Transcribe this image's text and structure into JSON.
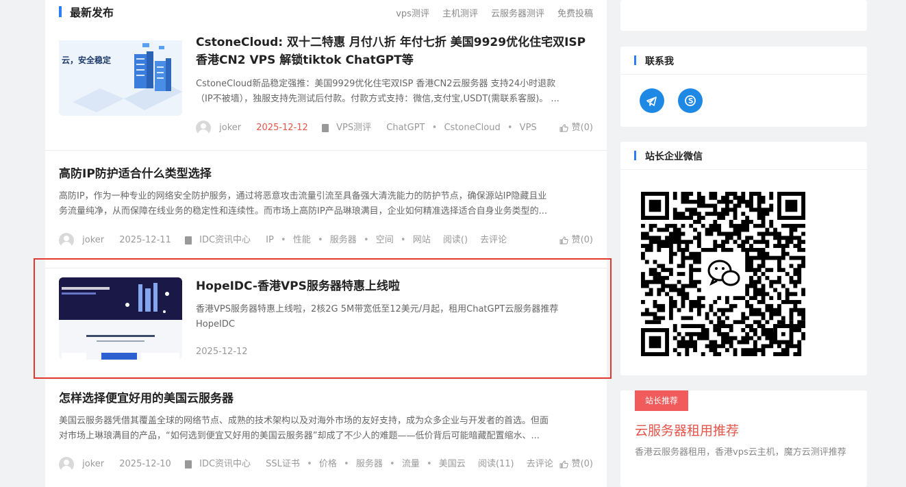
{
  "section": {
    "title": "最新发布",
    "links": [
      "vps测评",
      "主机测评",
      "云服务器测评",
      "免费投稿"
    ]
  },
  "posts": [
    {
      "title_line1": "CstoneCloud: 双十二特惠 月付八折 年付七折 美国9929优化住宅双ISP",
      "title_line2": "香港CN2 VPS 解锁tiktok ChatGPT等",
      "excerpt_line1": "CstoneCloud新品稳定强推：美国9929优化住宅双ISP 香港CN2云服务器 支持24小时退款",
      "excerpt_line2": "（IP不被墙），独服支持先测试后付款。付款方式支持：微信,支付宝,USDT(需联系客服)。 ...",
      "thumb_text": "云，安全稳定",
      "author": "joker",
      "date": "2025-12-12",
      "category": "VPS测评",
      "tags": [
        "ChatGPT",
        "CstoneCloud",
        "VPS"
      ],
      "like": "赞(0)"
    },
    {
      "title": "高防IP防护适合什么类型选择",
      "excerpt_line1": "高防IP，作为一种专业的网络安全防护服务，通过将恶意攻击流量引流至具备强大清洗能力的防护节点，确保源站IP隐藏且业",
      "excerpt_line2": "务流量纯净，从而保障在线业务的稳定性和连续性。而市场上高防IP产品琳琅满目，企业如何精准选择适合自身业务类型的...",
      "author": "joker",
      "date": "2025-12-11",
      "category": "IDC资讯中心",
      "tags": [
        "IP",
        "性能",
        "服务器",
        "空间",
        "网站"
      ],
      "reads": "阅读()",
      "comment": "去评论",
      "like": "赞(0)"
    },
    {
      "title": "HopeIDC-香港VPS服务器特惠上线啦",
      "excerpt_line1": "香港VPS服务器特惠上线啦，2核2G 5M带宽低至12美元/月起，租用ChatGPT云服务器推荐",
      "excerpt_line2": "HopeIDC",
      "date": "2025-12-12"
    },
    {
      "title": "怎样选择便宜好用的美国云服务器",
      "excerpt_line1": "美国云服务器凭借其覆盖全球的网络节点、成熟的技术架构以及对海外市场的友好支持，成为众多企业与开发者的首选。但面",
      "excerpt_line2": "对市场上琳琅满目的产品，“如何选到便宜又好用的美国云服务器”却成了不少人的难题——低价背后可能暗藏配置缩水、...",
      "author": "joker",
      "date": "2025-12-10",
      "category": "IDC资讯中心",
      "tags": [
        "SSL证书",
        "价格",
        "服务器",
        "流量",
        "美国云"
      ],
      "reads": "阅读(11)",
      "comment": "去评论",
      "like": "赞(0)"
    }
  ],
  "sidebar": {
    "contact_title": "联系我",
    "wechat_title": "站长企业微信",
    "recommend": {
      "badge": "站长推荐",
      "title": "云服务器租用推荐",
      "desc": "香港云服务器租用，香港vps云主机，魔方云测评推荐"
    }
  },
  "colors": {
    "accent": "#2d7df6",
    "date_highlight": "#e4554a",
    "highlight_border": "#e4372f",
    "badge": "#f25b5b"
  }
}
